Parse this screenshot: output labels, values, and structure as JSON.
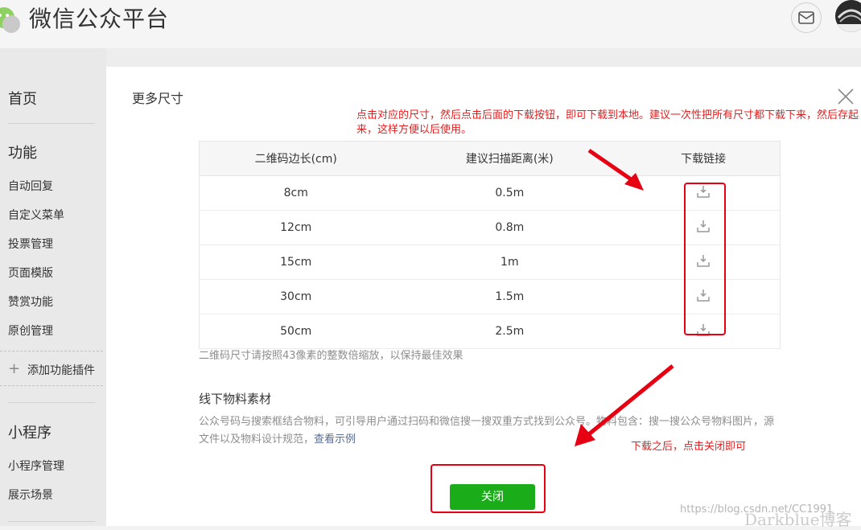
{
  "header": {
    "brand": "微信公众平台",
    "icons": {
      "logo": "wechat-logo-icon",
      "message": "mail-icon",
      "avatar": "avatar"
    }
  },
  "sidebar": {
    "home": "首页",
    "section_function": "功能",
    "items": [
      "自动回复",
      "自定义菜单",
      "投票管理",
      "页面模版",
      "赞赏功能",
      "原创管理"
    ],
    "add_plugin": "添加功能插件",
    "section_mini": "小程序",
    "mini_items": [
      "小程序管理",
      "展示场景"
    ]
  },
  "dialog": {
    "title": "更多尺寸",
    "annotation_top": "点击对应的尺寸，然后点击后面的下载按钮，即可下载到本地。建议一次性把所有尺寸都下载下来，然后存起来，这样方便以后使用。",
    "table": {
      "headers": [
        "二维码边长(cm)",
        "建议扫描距离(米)",
        "下载链接"
      ],
      "rows": [
        {
          "size": "8cm",
          "distance": "0.5m"
        },
        {
          "size": "12cm",
          "distance": "0.8m"
        },
        {
          "size": "15cm",
          "distance": "1m"
        },
        {
          "size": "30cm",
          "distance": "1.5m"
        },
        {
          "size": "50cm",
          "distance": "2.5m"
        }
      ]
    },
    "hint": "二维码尺寸请按照43像素的整数倍缩放，以保持最佳效果",
    "offline_title": "线下物料素材",
    "offline_desc": "公众号码与搜索框结合物料，可引导用户通过扫码和微信搜一搜双重方式找到公众号。物料包含：搜一搜公众号物料图片，源文件以及物料设计规范，",
    "offline_link": "查看示例",
    "annotation_bottom": "下载之后，点击关闭即可",
    "close_button": "关闭"
  },
  "watermark": {
    "url": "https://blog.csdn.net/CC1991",
    "blog": "Darkblue博客"
  },
  "colors": {
    "accent_green": "#1aad19",
    "annotation_red": "#e60012",
    "link": "#576b95"
  }
}
